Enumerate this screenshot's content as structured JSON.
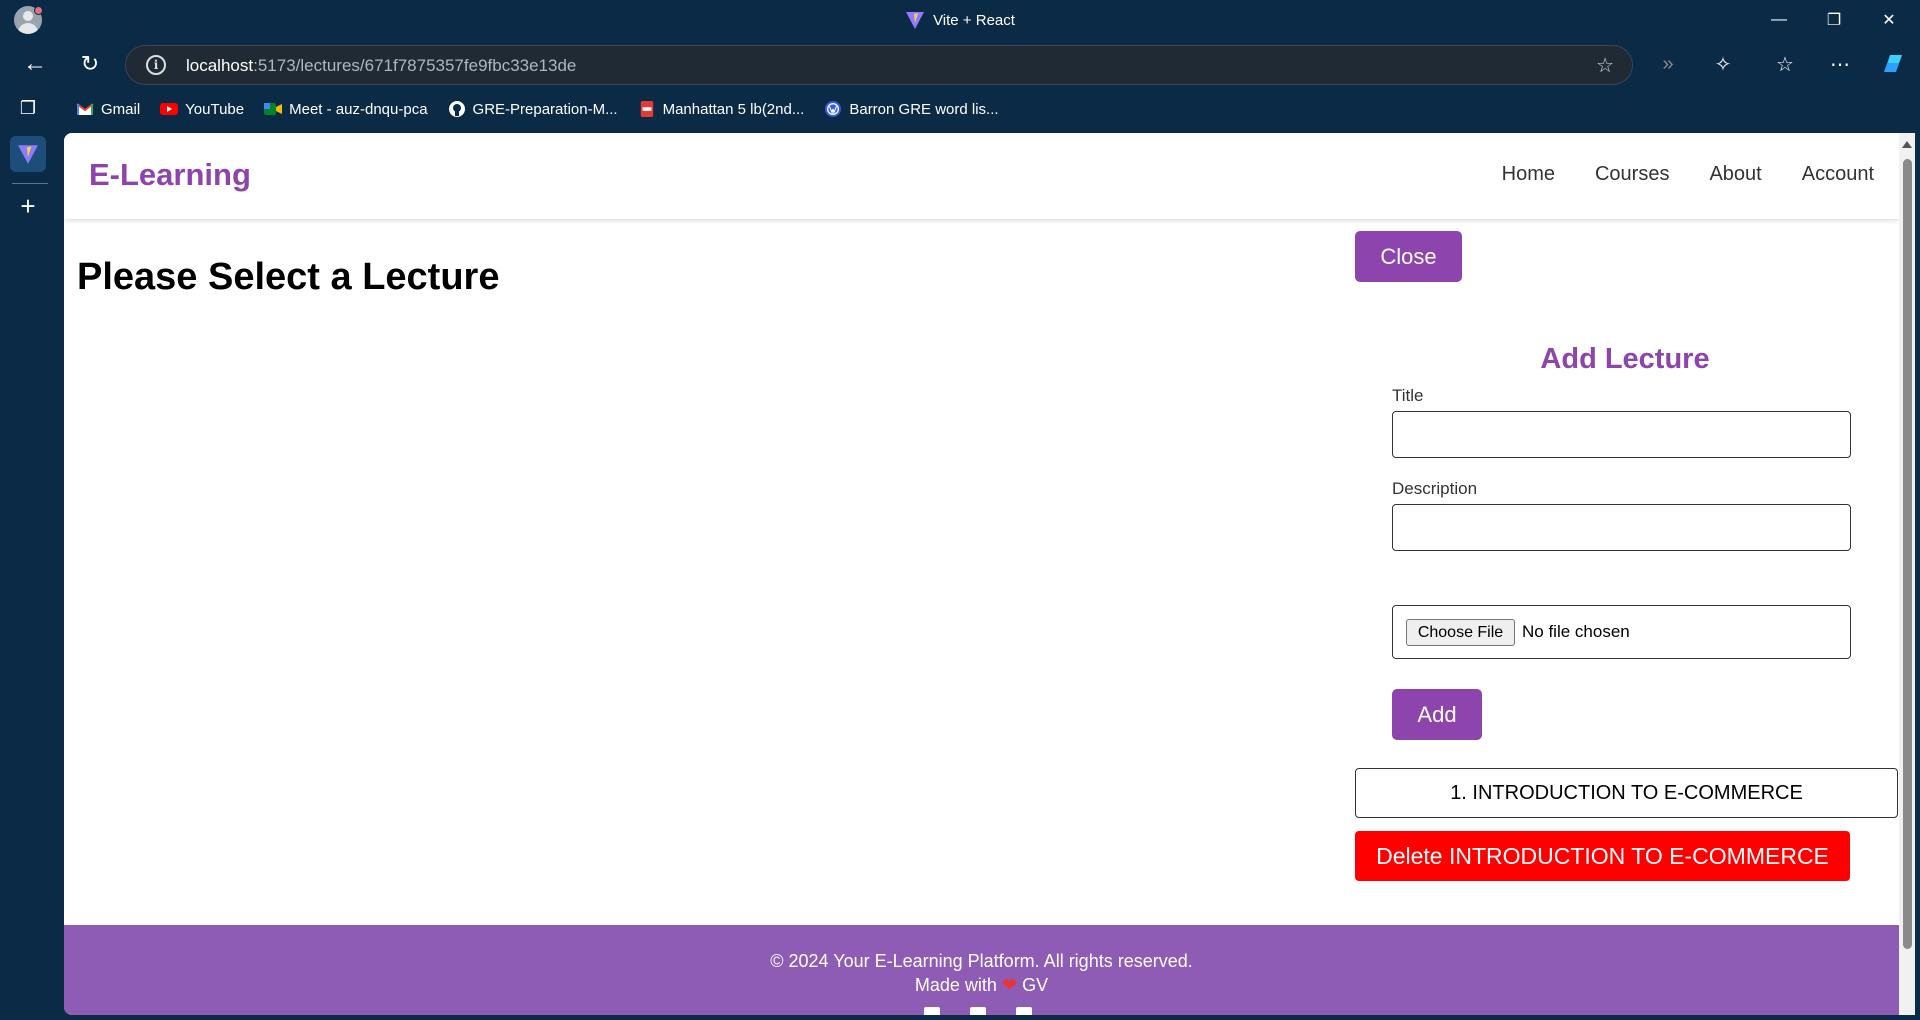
{
  "browser": {
    "window_title": "Vite + React",
    "url_host": "localhost",
    "url_rest": ":5173/lectures/671f7875357fe9fbc33e13de",
    "bookmarks": [
      {
        "label": "Gmail",
        "icon": "gmail-icon"
      },
      {
        "label": "YouTube",
        "icon": "youtube-icon"
      },
      {
        "label": "Meet - auz-dnqu-pca",
        "icon": "meet-icon"
      },
      {
        "label": "GRE-Preparation-M...",
        "icon": "github-icon"
      },
      {
        "label": "Manhattan 5 lb(2nd...",
        "icon": "pdf-icon"
      },
      {
        "label": "Barron GRE word lis...",
        "icon": "wordpress-icon"
      }
    ]
  },
  "header": {
    "logo": "E-Learning",
    "nav": [
      "Home",
      "Courses",
      "About",
      "Account"
    ]
  },
  "main": {
    "title": "Please Select a Lecture"
  },
  "panel": {
    "close_label": "Close",
    "form_title": "Add Lecture",
    "title_label": "Title",
    "title_value": "",
    "description_label": "Description",
    "description_value": "",
    "choose_file_label": "Choose File",
    "no_file_text": "No file chosen",
    "add_label": "Add",
    "lectures": [
      {
        "label": "1. INTRODUCTION TO E-COMMERCE",
        "delete_label": "Delete INTRODUCTION TO E-COMMERCE"
      }
    ]
  },
  "footer": {
    "copyright": "© 2024 Your E-Learning Platform. All rights reserved.",
    "made_with_prefix": "Made with",
    "made_with_suffix": "GV"
  },
  "colors": {
    "brand": "#8e44ad",
    "footer": "#8e5bb5",
    "delete": "#ff0000"
  }
}
